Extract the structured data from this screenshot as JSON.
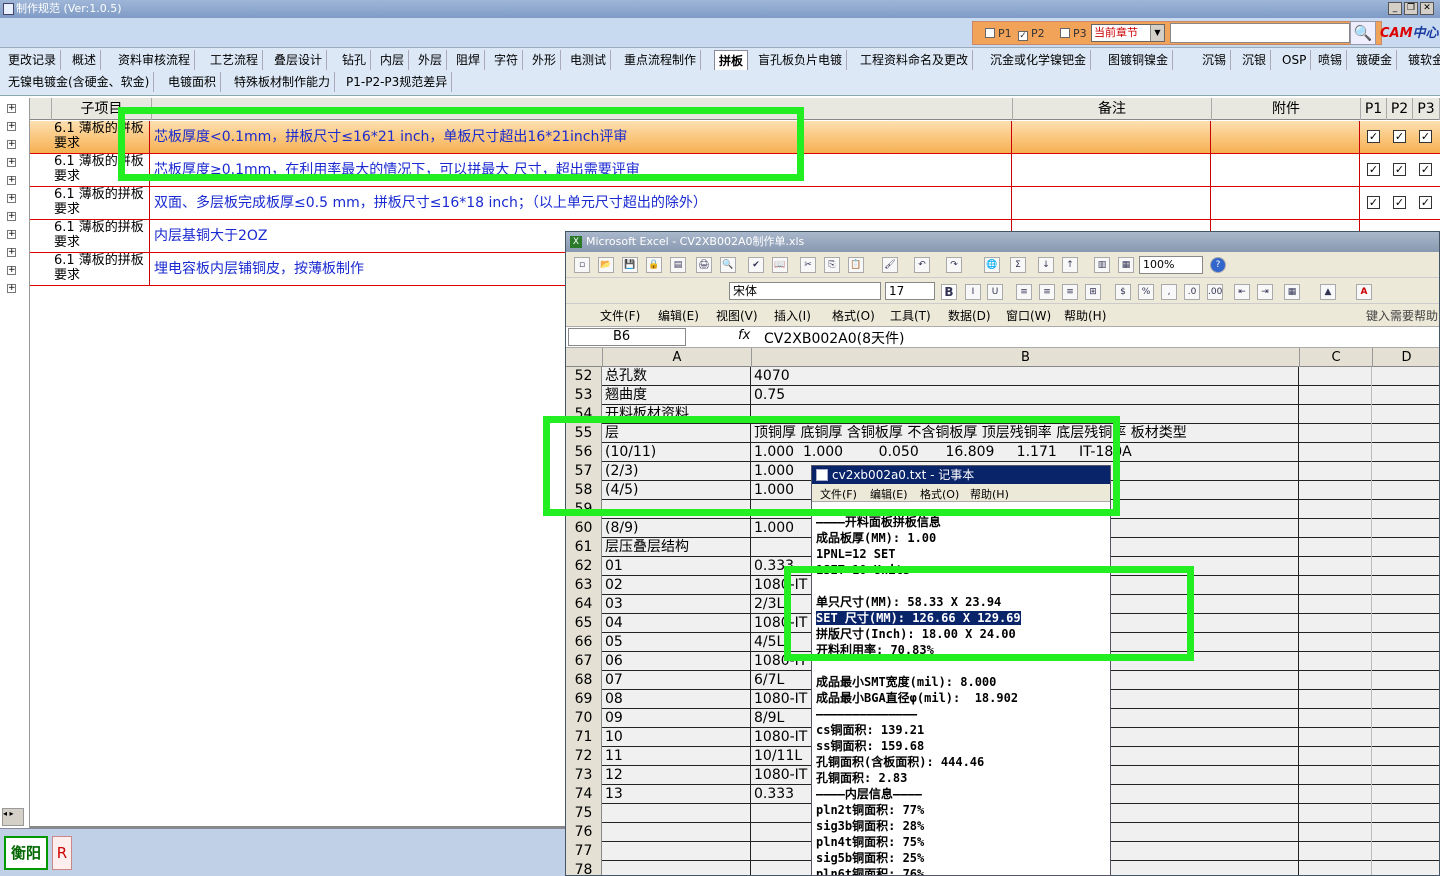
{
  "app": {
    "title": "制作规范 (Ver:1.0.5)"
  },
  "toolbar": {
    "p_filters": [
      {
        "label": "P1",
        "checked": false
      },
      {
        "label": "P2",
        "checked": true
      },
      {
        "label": "P3",
        "checked": false
      }
    ],
    "chapter_select": "当前章节",
    "search_value": "",
    "logo_cam": "CAM",
    "logo_center": "中心"
  },
  "tabs": {
    "row1": [
      "更改记录",
      "概述",
      "资料审核流程",
      "工艺流程",
      "叠层设计",
      "钻孔",
      "内层",
      "外层",
      "阻焊",
      "字符",
      "外形",
      "电测试",
      "重点流程制作",
      "拼板",
      "盲孔板负片电镀",
      "工程资料命名及更改",
      "沉金或化学镍钯金",
      "图镀铜镍金",
      "沉锡",
      "沉银",
      "OSP",
      "喷锡",
      "镀硬金",
      "镀软金"
    ],
    "row2": [
      "无镍电镀金(含硬金、软金)",
      "电镀面积",
      "特殊板材制作能力",
      "P1-P2-P3规范差异"
    ],
    "active": "拼板"
  },
  "grid": {
    "headers": {
      "sub_item": "子项目",
      "remark": "备注",
      "attachment": "附件",
      "p1": "P1",
      "p2": "P2",
      "p3": "P3"
    },
    "rows": [
      {
        "sub": "6.1 薄板的拼板要求",
        "content": "芯板厚度<0.1mm，拼板尺寸≤16*21 inch，单板尺寸超出16*21inch评审",
        "p1": true,
        "p2": true,
        "p3": true,
        "selected": true
      },
      {
        "sub": "6.1 薄板的拼板要求",
        "content": "芯板厚度≥0.1mm，在利用率最大的情况下，可以拼最大 尺寸，超出需要评审",
        "p1": true,
        "p2": true,
        "p3": true,
        "selected": false
      },
      {
        "sub": "6.1 薄板的拼板要求",
        "content": "双面、多层板完成板厚≤0.5 mm，拼板尺寸≤16*18 inch；（以上单元尺寸超出的除外）",
        "p1": true,
        "p2": true,
        "p3": true,
        "selected": false
      },
      {
        "sub": "6.1 薄板的拼板要求",
        "content": "内层基铜大于2OZ",
        "p1": false,
        "p2": false,
        "p3": false,
        "selected": false
      },
      {
        "sub": "6.1 薄板的拼板要求",
        "content": "埋电容板内层铺铜皮，按薄板制作",
        "p1": false,
        "p2": false,
        "p3": false,
        "selected": false
      }
    ]
  },
  "status": {
    "site": "衡阳",
    "r_label": "R"
  },
  "excel": {
    "title": "Microsoft Excel - CV2XB002A0制作单.xls",
    "font_name": "宋体",
    "font_size": "17",
    "zoom": "100%",
    "menu": [
      "文件(F)",
      "编辑(E)",
      "视图(V)",
      "插入(I)",
      "格式(O)",
      "工具(T)",
      "数据(D)",
      "窗口(W)",
      "帮助(H)"
    ],
    "help_hint": "键入需要帮助",
    "cell_ref": "B6",
    "fx": "fx",
    "formula": "CV2XB002A0(8天件)",
    "columns": [
      "A",
      "B",
      "C",
      "D"
    ],
    "rows": [
      {
        "n": "52",
        "a": "总孔数",
        "b": "4070"
      },
      {
        "n": "53",
        "a": "翘曲度",
        "b": "0.75"
      },
      {
        "n": "54",
        "a": "开料板材资料",
        "b": ""
      },
      {
        "n": "55",
        "a": "层",
        "b": "顶铜厚 底铜厚 含铜板厚 不含铜板厚 顶层残铜率 底层残铜率 板材类型"
      },
      {
        "n": "56",
        "a": "(10/11)",
        "b": "1.000  1.000        0.050      16.809     1.171     IT-180A"
      },
      {
        "n": "57",
        "a": "(2/3)",
        "b": "1.000"
      },
      {
        "n": "58",
        "a": "(4/5)",
        "b": "1.000"
      },
      {
        "n": "59",
        "a": "",
        "b": ""
      },
      {
        "n": "60",
        "a": "(8/9)",
        "b": "1.000"
      },
      {
        "n": "61",
        "a": "层压叠层结构",
        "b": ""
      },
      {
        "n": "62",
        "a": "01",
        "b": "0.333"
      },
      {
        "n": "63",
        "a": "02",
        "b": "1080-IT"
      },
      {
        "n": "64",
        "a": "03",
        "b": "2/3L"
      },
      {
        "n": "65",
        "a": "04",
        "b": "1080-IT"
      },
      {
        "n": "66",
        "a": "05",
        "b": "4/5L"
      },
      {
        "n": "67",
        "a": "06",
        "b": "1080-IT"
      },
      {
        "n": "68",
        "a": "07",
        "b": "6/7L"
      },
      {
        "n": "69",
        "a": "08",
        "b": "1080-IT"
      },
      {
        "n": "70",
        "a": "09",
        "b": "8/9L"
      },
      {
        "n": "71",
        "a": "10",
        "b": "1080-IT"
      },
      {
        "n": "72",
        "a": "11",
        "b": "10/11L"
      },
      {
        "n": "73",
        "a": "12",
        "b": "1080-IT"
      },
      {
        "n": "74",
        "a": "13",
        "b": "0.333"
      },
      {
        "n": "75",
        "a": "",
        "b": ""
      },
      {
        "n": "76",
        "a": "",
        "b": ""
      },
      {
        "n": "77",
        "a": "",
        "b": ""
      },
      {
        "n": "78",
        "a": "",
        "b": ""
      }
    ]
  },
  "notepad": {
    "title": "cv2xb002a0.txt - 记事本",
    "menu": [
      "文件(F)",
      "编辑(E)",
      "格式(O)",
      "帮助(H)"
    ],
    "lines": [
      "————开料面板拼板信息",
      "成品板厚(MM): 1.00",
      "1PNL=12 SET",
      "1SET=10 Units",
      "",
      "单只尺寸(MM): 58.33 X 23.94",
      "SET 尺寸(MM): 126.66 X 129.69",
      "拼版尺寸(Inch): 18.00 X 24.00",
      "开料利用率: 70.83%",
      "",
      "成品最小SMT宽度(mil): 8.000",
      "成品最小BGA直径φ(mil):  18.902",
      "——————————————",
      "cs铜面积: 139.21",
      "ss铜面积: 159.68",
      "孔铜面积(含板面积): 444.46",
      "孔铜面积: 2.83",
      "————内层信息————",
      "pln2t铜面积: 77%",
      "sig3b铜面积: 28%",
      "pln4t铜面积: 75%",
      "sig5b铜面积: 25%",
      "pln6t铜面积: 76%"
    ],
    "highlight_index": 6
  },
  "colors": {
    "highlight_box": "#22ee22",
    "selected_row": "#f8b860",
    "accent_blue": "#0a246a"
  }
}
